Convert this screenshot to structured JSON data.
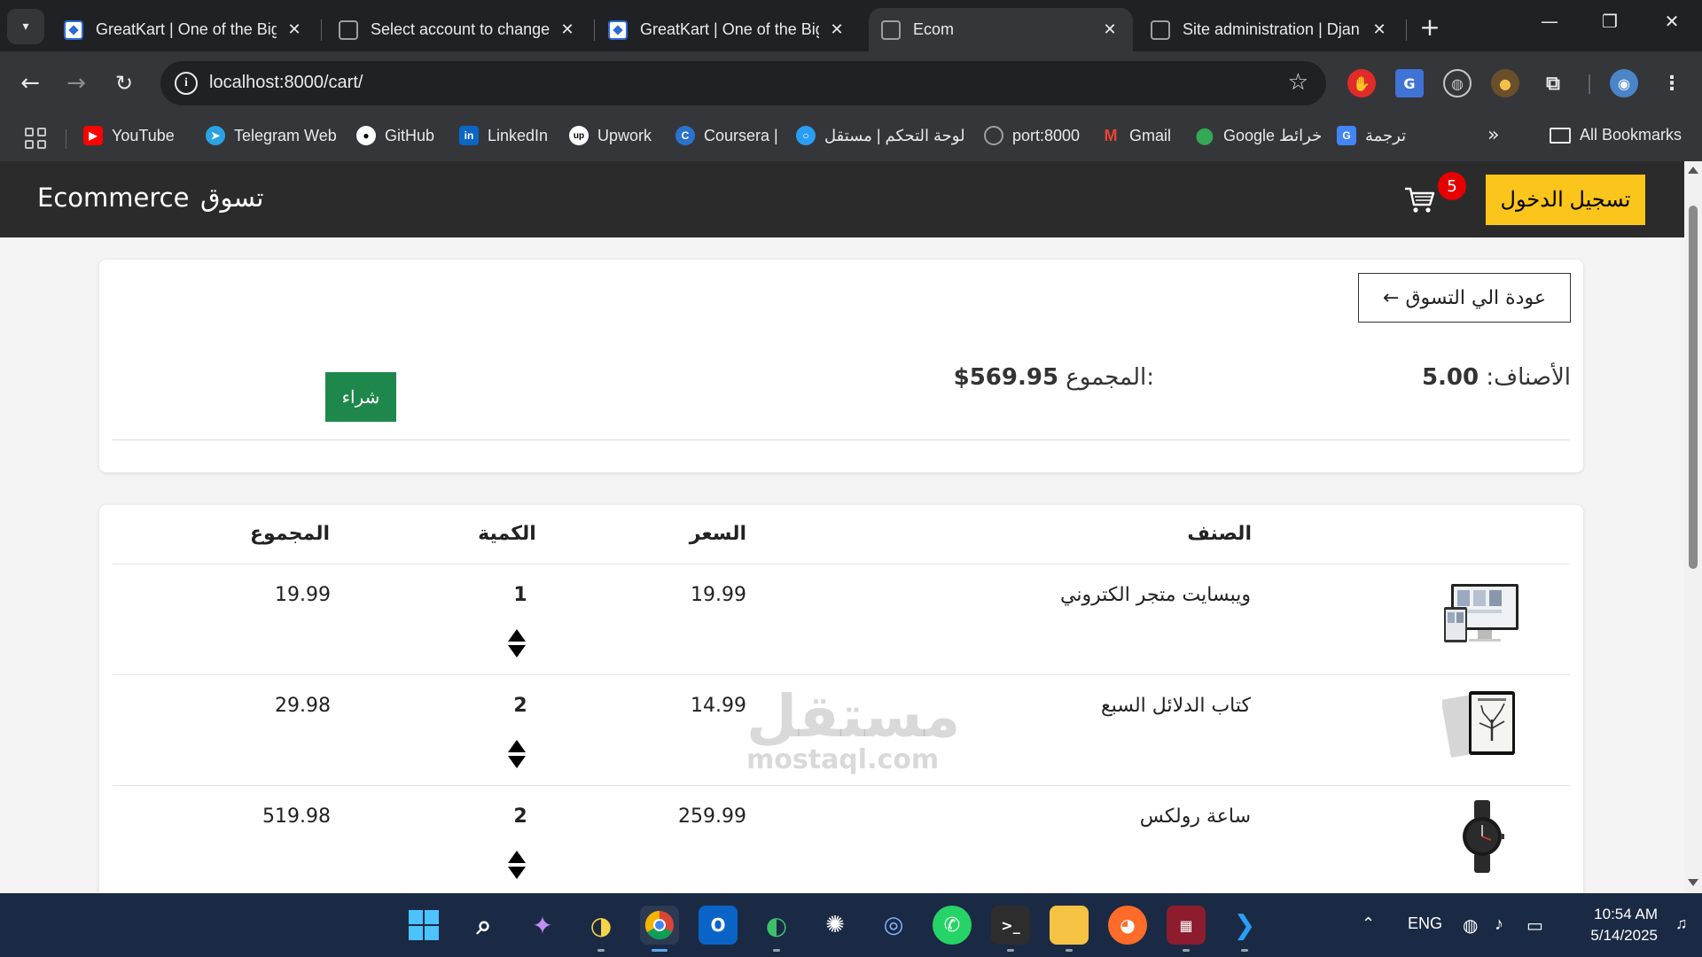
{
  "browser": {
    "tabs": [
      {
        "title": "GreatKart | One of the Bigg",
        "favicon": "greatkart-icon",
        "active": false
      },
      {
        "title": "Select account to change",
        "favicon": "globe-icon",
        "active": false
      },
      {
        "title": "GreatKart | One of the Bigg",
        "favicon": "greatkart-icon",
        "active": false
      },
      {
        "title": "Ecom",
        "favicon": "globe-icon",
        "active": true
      },
      {
        "title": "Site administration | Djan",
        "favicon": "globe-icon",
        "active": false
      }
    ],
    "url": "localhost:8000/cart/",
    "bookmarks": [
      {
        "label": "YouTube",
        "icon": "youtube-icon",
        "color": "#ff0000"
      },
      {
        "label": "Telegram Web",
        "icon": "telegram-icon",
        "color": "#2aa3e0"
      },
      {
        "label": "GitHub",
        "icon": "github-icon",
        "color": "#ffffff"
      },
      {
        "label": "LinkedIn",
        "icon": "linkedin-icon",
        "color": "#0a66c2"
      },
      {
        "label": "Upwork",
        "icon": "upwork-icon",
        "color": "#ffffff"
      },
      {
        "label": "Coursera |",
        "icon": "coursera-icon",
        "color": "#2a73cc"
      },
      {
        "label": "لوحة التحكم | مستقل",
        "icon": "mostaql-icon",
        "color": "#2a9df4"
      },
      {
        "label": "port:8000",
        "icon": "globe-icon",
        "color": "#9aa0a6"
      },
      {
        "label": "Gmail",
        "icon": "gmail-icon",
        "color": "#ea4335"
      },
      {
        "label": "Google خرائط",
        "icon": "maps-icon",
        "color": "#34a853"
      },
      {
        "label": "ترجمة",
        "icon": "translate-icon",
        "color": "#4285f4"
      }
    ],
    "all_bookmarks": "All Bookmarks"
  },
  "site": {
    "brand": "Ecommerce",
    "nav_shop": "تسوق",
    "login": "تسجيل الدخول",
    "cart_count": "5",
    "accent_color": "#fcc51c"
  },
  "summary": {
    "back": "← عودة الي التسوق",
    "items_label": "الأصناف:",
    "items_value": "5.00",
    "total_label": "المجموع:",
    "total_value": "$569.95",
    "buy": "شراء"
  },
  "table": {
    "headers": {
      "item": "الصنف",
      "price": "السعر",
      "quantity": "الكمية",
      "total": "المجموع"
    },
    "rows": [
      {
        "name": "ويبسايت متجر الكتروني",
        "price": "19.99",
        "quantity": "1",
        "total": "19.99",
        "image": "website-thumbnail"
      },
      {
        "name": "كتاب الدلائل السبع",
        "price": "14.99",
        "quantity": "2",
        "total": "29.98",
        "image": "book-thumbnail"
      },
      {
        "name": "ساعة رولكس",
        "price": "259.99",
        "quantity": "2",
        "total": "519.98",
        "image": "watch-thumbnail"
      }
    ]
  },
  "watermark": {
    "text": "مستقل",
    "sub": "mostaql.com"
  },
  "taskbar": {
    "lang": "ENG",
    "time": "10:54 AM",
    "date": "5/14/2025"
  }
}
